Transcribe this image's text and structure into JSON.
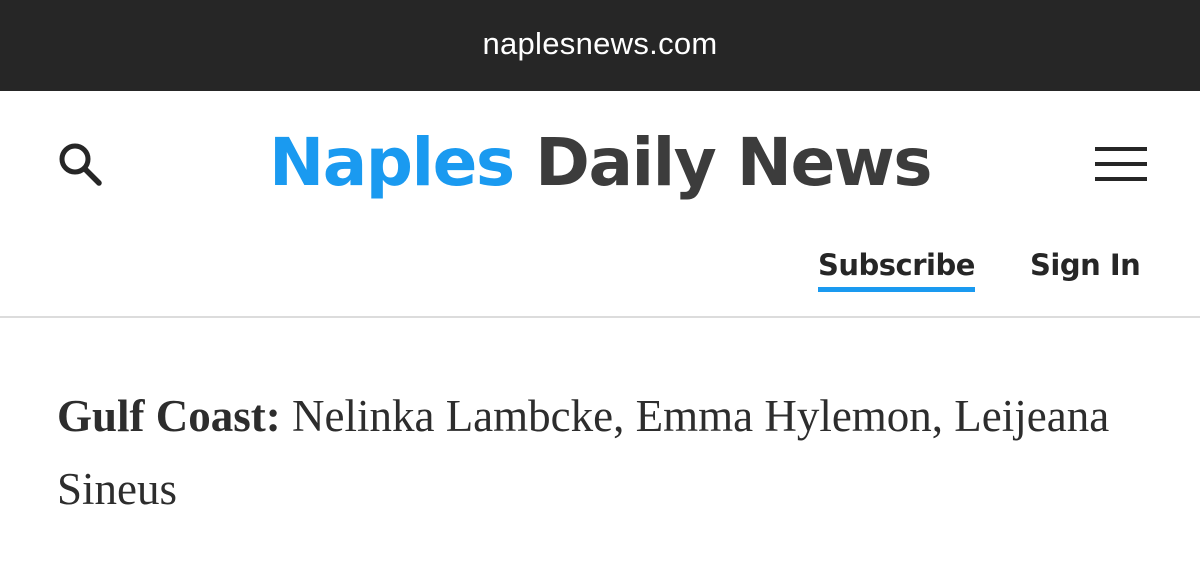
{
  "browser": {
    "url": "naplesnews.com"
  },
  "header": {
    "logo_primary": "Naples",
    "logo_secondary": "Daily News",
    "subscribe_label": "Subscribe",
    "signin_label": "Sign In",
    "search_icon": "search-icon",
    "menu_icon": "hamburger-menu-icon"
  },
  "article": {
    "label": "Gulf Coast:",
    "text": " Nelinka Lambcke, Emma Hylemon, Leijeana Sineus"
  },
  "colors": {
    "brand_blue": "#1a9af0",
    "dark_text": "#262626",
    "url_bar_bg": "#262626"
  }
}
